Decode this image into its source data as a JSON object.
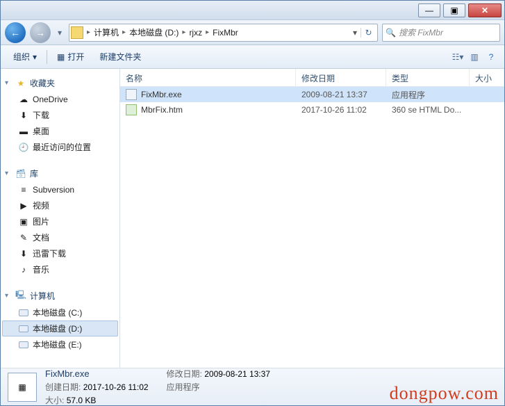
{
  "titlebar": {
    "min": "—",
    "max": "▣",
    "close": "✕"
  },
  "nav": {
    "back": "←",
    "fwd": "→",
    "drop": "▾",
    "crumbs": [
      "计算机",
      "本地磁盘 (D:)",
      "rjxz",
      "FixMbr"
    ],
    "sep": "▸",
    "refresh": "↻",
    "search_placeholder": "搜索 FixMbr"
  },
  "toolbar": {
    "organize": "组织",
    "organize_drop": "▾",
    "open": "打开",
    "open_icon": "▦",
    "newfolder": "新建文件夹",
    "view_drop": "▾",
    "help": "?"
  },
  "sidebar": {
    "fav": {
      "label": "收藏夹",
      "arrow": "▾",
      "items": [
        {
          "icon": "☁",
          "label": "OneDrive"
        },
        {
          "icon": "⬇",
          "label": "下载"
        },
        {
          "icon": "▬",
          "label": "桌面"
        },
        {
          "icon": "🕘",
          "label": "最近访问的位置"
        }
      ]
    },
    "lib": {
      "label": "库",
      "arrow": "▾",
      "items": [
        {
          "icon": "≡",
          "label": "Subversion"
        },
        {
          "icon": "▶",
          "label": "视频"
        },
        {
          "icon": "▣",
          "label": "图片"
        },
        {
          "icon": "✎",
          "label": "文档"
        },
        {
          "icon": "⬇",
          "label": "迅雷下载"
        },
        {
          "icon": "♪",
          "label": "音乐"
        }
      ]
    },
    "pc": {
      "label": "计算机",
      "arrow": "▾",
      "items": [
        {
          "icon": "⛁",
          "label": "本地磁盘 (C:)"
        },
        {
          "icon": "⛃",
          "label": "本地磁盘 (D:)",
          "selected": true
        },
        {
          "icon": "⛃",
          "label": "本地磁盘 (E:)"
        }
      ]
    }
  },
  "columns": {
    "name": "名称",
    "date": "修改日期",
    "type": "类型",
    "size": "大小"
  },
  "files": [
    {
      "name": "FixMbr.exe",
      "date": "2009-08-21 13:37",
      "type": "应用程序",
      "selected": true,
      "icon": "exe"
    },
    {
      "name": "MbrFix.htm",
      "date": "2017-10-26 11:02",
      "type": "360 se HTML Do...",
      "icon": "htm"
    }
  ],
  "details": {
    "name": "FixMbr.exe",
    "type": "应用程序",
    "mod_label": "修改日期:",
    "mod": "2009-08-21 13:37",
    "size_label": "大小:",
    "size": "57.0 KB",
    "created_label": "创建日期:",
    "created": "2017-10-26 11:02"
  },
  "watermark": "dongpow.com"
}
